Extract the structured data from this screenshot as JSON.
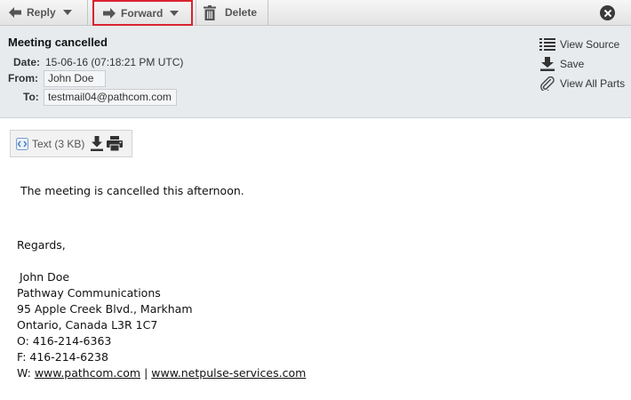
{
  "toolbar": {
    "reply_label": "Reply",
    "forward_label": "Forward",
    "delete_label": "Delete"
  },
  "message": {
    "subject": "Meeting cancelled",
    "date_label": "Date:",
    "date_value": "15-06-16 (07:18:21 PM UTC)",
    "from_label": "From:",
    "from_value": "John Doe",
    "to_label": "To:",
    "to_value": "testmail04@pathcom.com"
  },
  "actions": {
    "view_source": "View Source",
    "save": "Save",
    "view_all_parts": "View All Parts"
  },
  "attachment": {
    "label": "Text (3 KB)"
  },
  "body": {
    "line1": "The meeting is cancelled this afternoon.",
    "regards": "Regards,",
    "sig_name": "John Doe",
    "sig_company": "Pathway Communications",
    "sig_address1": "95 Apple Creek Blvd., Markham",
    "sig_address2": "Ontario, Canada L3R 1C7",
    "sig_phone": "O: 416-214-6363",
    "sig_fax": "F: 416-214-6238",
    "sig_web_prefix": "W: ",
    "sig_link1": "www.pathcom.com",
    "sig_separator": " | ",
    "sig_link2": "www.netpulse-services.com"
  },
  "colors": {
    "highlight_border": "#d9232f",
    "header_bg": "#e7ebee"
  }
}
